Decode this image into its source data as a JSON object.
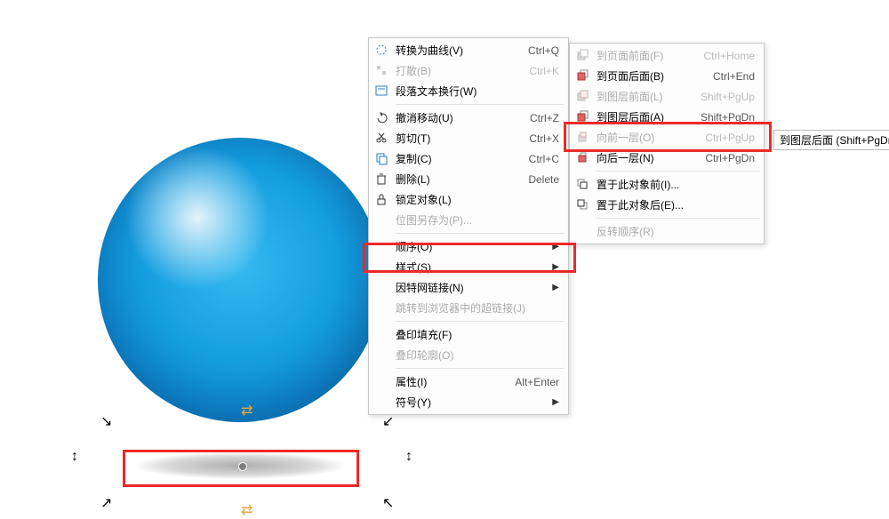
{
  "menu": {
    "convert": "转换为曲线(V)",
    "convert_sc": "Ctrl+Q",
    "break_apart": "打散(B)",
    "break_sc": "Ctrl+K",
    "para_wrap": "段落文本换行(W)",
    "undo_move": "撤消移动(U)",
    "undo_sc": "Ctrl+Z",
    "cut": "剪切(T)",
    "cut_sc": "Ctrl+X",
    "copy": "复制(C)",
    "copy_sc": "Ctrl+C",
    "delete": "删除(L)",
    "delete_sc": "Delete",
    "lock": "锁定对象(L)",
    "save_bmp": "位图另存为(P)...",
    "order": "顺序(O)",
    "style": "样式(S)",
    "link": "因特网链接(N)",
    "jump": "跳转到浏览器中的超链接(J)",
    "ovp_fill": "叠印填充(F)",
    "ovp_outline": "叠印轮廓(O)",
    "props": "属性(I)",
    "props_sc": "Alt+Enter",
    "symbol": "符号(Y)"
  },
  "sub": {
    "page_front": "到页面前面(F)",
    "page_front_sc": "Ctrl+Home",
    "page_back": "到页面后面(B)",
    "page_back_sc": "Ctrl+End",
    "layer_front": "到图层前面(L)",
    "layer_front_sc": "Shift+PgUp",
    "layer_back": "到图层后面(A)",
    "layer_back_sc": "Shift+PgDn",
    "fwd_one": "向前一层(O)",
    "fwd_one_sc": "Ctrl+PgUp",
    "back_one": "向后一层(N)",
    "back_one_sc": "Ctrl+PgDn",
    "in_front": "置于此对象前(I)...",
    "behind": "置于此对象后(E)...",
    "reverse": "反转顺序(R)"
  },
  "tooltip": "到图层后面 (Shift+PgDn)",
  "colors": {
    "highlight_red": "#ec2a2a",
    "menu_border": "#c7c7c7"
  }
}
